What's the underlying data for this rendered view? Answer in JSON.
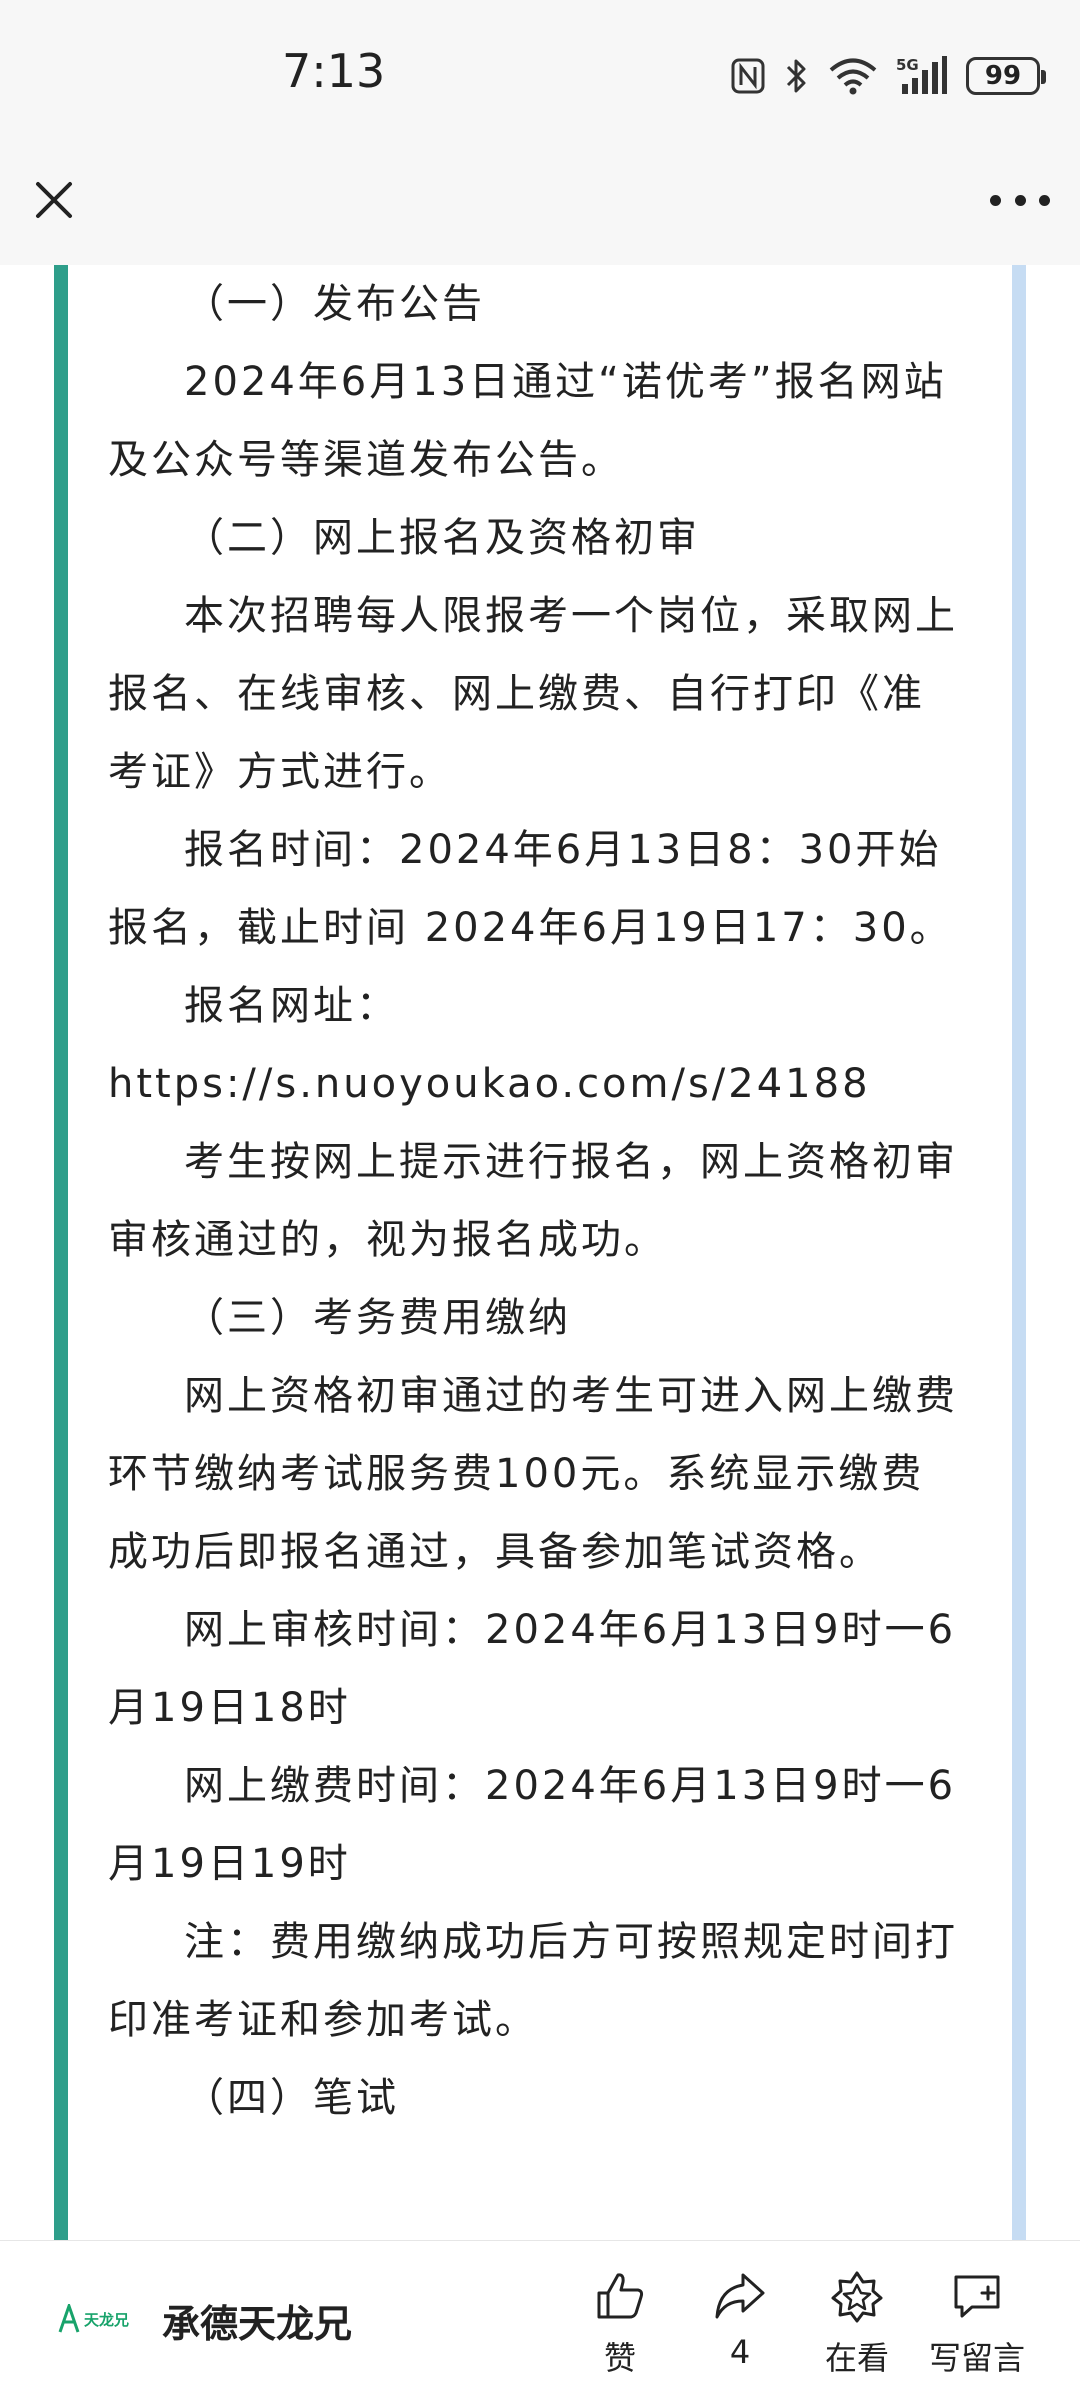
{
  "status_bar": {
    "time": "7:13",
    "battery": "99",
    "network": "5G",
    "icons": [
      "nfc-icon",
      "bluetooth-icon",
      "wifi-icon",
      "signal-icon",
      "battery-icon"
    ]
  },
  "nav": {
    "icons": [
      "close-icon",
      "more-icon"
    ]
  },
  "article": {
    "paragraphs": [
      "（一）发布公告",
      "2024年6月13日通过“诺优考”报名网站及公众号等渠道发布公告。",
      "（二）网上报名及资格初审",
      "本次招聘每人限报考一个岗位，采取网上报名、在线审核、网上缴费、自行打印《准考证》方式进行。",
      "报名时间：2024年6月13日8：30开始报名，截止时间 2024年6月19日17：30。",
      "报名网址：",
      "https://s.nuoyoukao.com/s/24188",
      "考生按网上提示进行报名，网上资格初审审核通过的，视为报名成功。",
      "（三）考务费用缴纳",
      "网上资格初审通过的考生可进入网上缴费环节缴纳考试服务费100元。系统显示缴费成功后即报名通过，具备参加笔试资格。",
      "网上审核时间：2024年6月13日9时一6月19日18时",
      "网上缴费时间：2024年6月13日9时一6月19日19时",
      "注：费用缴纳成功后方可按照规定时间打印准考证和参加考试。",
      "（四）笔试"
    ],
    "colors": {
      "left_bar": "#2e9e8a",
      "right_bar": "#c6dcf3"
    }
  },
  "bottom_bar": {
    "logo_text": "天龙兄",
    "account_name": "承德天龙兄",
    "actions": [
      {
        "icon": "thumbs-up-icon",
        "label": "赞"
      },
      {
        "icon": "share-icon",
        "label": "4"
      },
      {
        "icon": "wow-icon",
        "label": "在看"
      },
      {
        "icon": "comment-icon",
        "label": "写留言"
      }
    ]
  }
}
